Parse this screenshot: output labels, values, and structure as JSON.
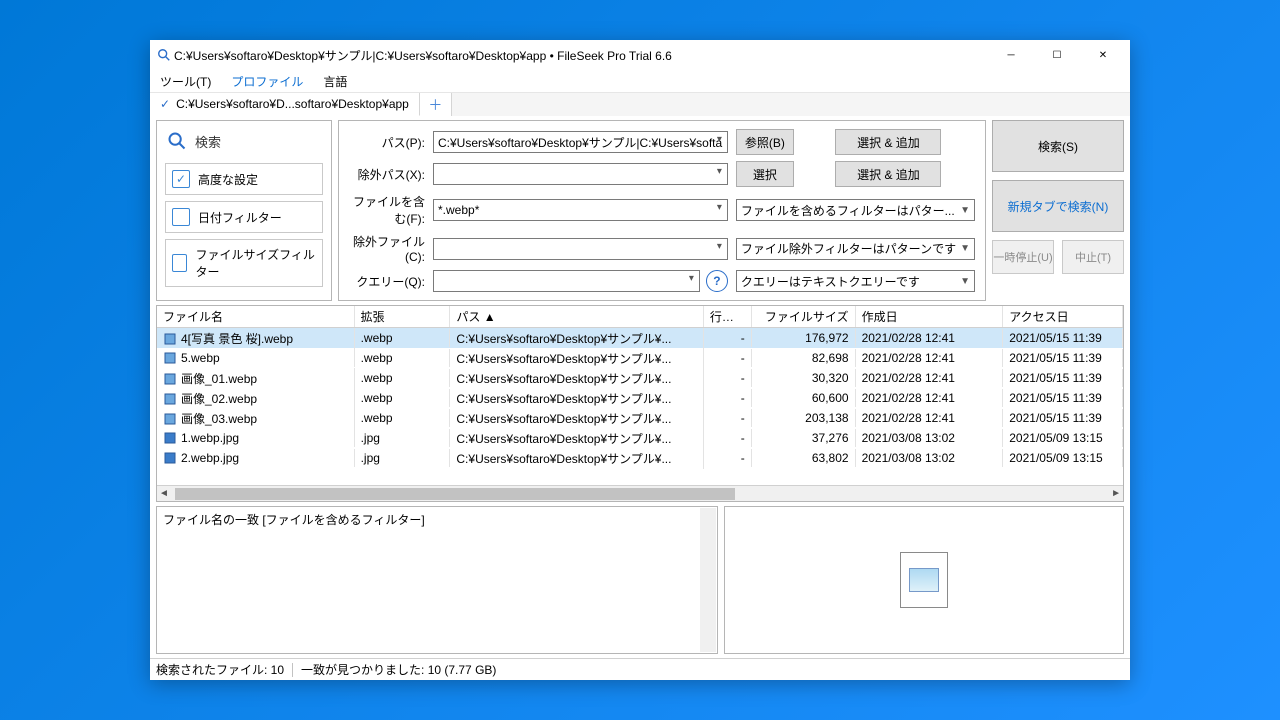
{
  "window": {
    "title": "C:¥Users¥softaro¥Desktop¥サンプル|C:¥Users¥softaro¥Desktop¥app • FileSeek Pro Trial 6.6"
  },
  "menu": {
    "tool": "ツール(T)",
    "profile": "プロファイル",
    "language": "言語"
  },
  "tab": {
    "label": "C:¥Users¥softaro¥D...softaro¥Desktop¥app"
  },
  "sidebar": {
    "search": "検索",
    "advanced": "高度な設定",
    "date_filter": "日付フィルター",
    "size_filter": "ファイルサイズフィルター"
  },
  "form": {
    "path_label": "パス(P):",
    "path_value": "C:¥Users¥softaro¥Desktop¥サンプル|C:¥Users¥softaro",
    "browse": "参照(B)",
    "select_add": "選択 & 追加",
    "exclude_path_label": "除外パス(X):",
    "exclude_path_value": "",
    "select": "選択",
    "include_label": "ファイルを含む(F):",
    "include_value": "*.webp*",
    "include_filter": "ファイルを含めるフィルターはパター...",
    "exclude_label": "除外ファイル(C):",
    "exclude_value": "",
    "exclude_filter": "ファイル除外フィルターはパターンです",
    "query_label": "クエリー(Q):",
    "query_value": "",
    "query_type": "クエリーはテキストクエリーです"
  },
  "actions": {
    "search": "検索(S)",
    "new_tab_search": "新規タブで検索(N)",
    "pause": "一時停止(U)",
    "stop": "中止(T)"
  },
  "columns": {
    "filename": "ファイル名",
    "ext": "拡張",
    "path": "パス ▲",
    "line": "行番号",
    "size": "ファイルサイズ",
    "created": "作成日",
    "accessed": "アクセス日"
  },
  "rows": [
    {
      "name": "4[写真 景色 桜].webp",
      "ext": ".webp",
      "path": "C:¥Users¥softaro¥Desktop¥サンプル¥...",
      "line": "-",
      "size": "176,972",
      "created": "2021/02/28 12:41",
      "accessed": "2021/05/15 11:39",
      "selected": true,
      "icon": "img"
    },
    {
      "name": "5.webp",
      "ext": ".webp",
      "path": "C:¥Users¥softaro¥Desktop¥サンプル¥...",
      "line": "-",
      "size": "82,698",
      "created": "2021/02/28 12:41",
      "accessed": "2021/05/15 11:39",
      "icon": "img"
    },
    {
      "name": "画像_01.webp",
      "ext": ".webp",
      "path": "C:¥Users¥softaro¥Desktop¥サンプル¥...",
      "line": "-",
      "size": "30,320",
      "created": "2021/02/28 12:41",
      "accessed": "2021/05/15 11:39",
      "icon": "img"
    },
    {
      "name": "画像_02.webp",
      "ext": ".webp",
      "path": "C:¥Users¥softaro¥Desktop¥サンプル¥...",
      "line": "-",
      "size": "60,600",
      "created": "2021/02/28 12:41",
      "accessed": "2021/05/15 11:39",
      "icon": "img"
    },
    {
      "name": "画像_03.webp",
      "ext": ".webp",
      "path": "C:¥Users¥softaro¥Desktop¥サンプル¥...",
      "line": "-",
      "size": "203,138",
      "created": "2021/02/28 12:41",
      "accessed": "2021/05/15 11:39",
      "icon": "img"
    },
    {
      "name": "1.webp.jpg",
      "ext": ".jpg",
      "path": "C:¥Users¥softaro¥Desktop¥サンプル¥...",
      "line": "-",
      "size": "37,276",
      "created": "2021/03/08 13:02",
      "accessed": "2021/05/09 13:15",
      "icon": "jpg"
    },
    {
      "name": "2.webp.jpg",
      "ext": ".jpg",
      "path": "C:¥Users¥softaro¥Desktop¥サンプル¥...",
      "line": "-",
      "size": "63,802",
      "created": "2021/03/08 13:02",
      "accessed": "2021/05/09 13:15",
      "icon": "jpg"
    }
  ],
  "preview": {
    "match_text": "ファイル名の一致 [ファイルを含めるフィルター]"
  },
  "status": {
    "found": "検索されたファイル: 10",
    "matches": "一致が見つかりました: 10 (7.77 GB)"
  }
}
